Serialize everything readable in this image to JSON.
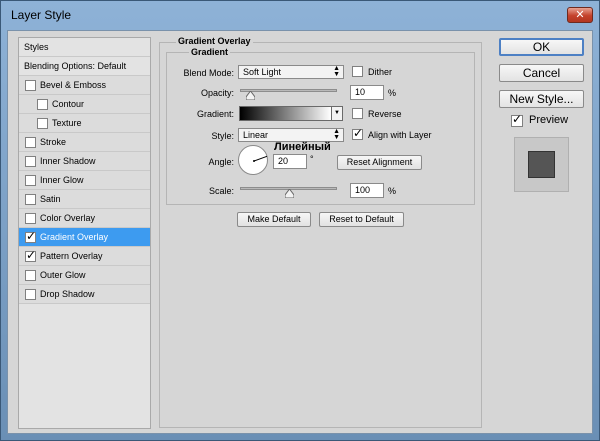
{
  "window": {
    "title": "Layer Style",
    "close_glyph": "✕"
  },
  "left_panel": {
    "items": [
      {
        "label": "Styles",
        "checkbox": false,
        "checked": false,
        "indent": false,
        "selected": false
      },
      {
        "label": "Blending Options: Default",
        "checkbox": false,
        "checked": false,
        "indent": false,
        "selected": false
      },
      {
        "label": "Bevel & Emboss",
        "checkbox": true,
        "checked": false,
        "indent": false,
        "selected": false
      },
      {
        "label": "Contour",
        "checkbox": true,
        "checked": false,
        "indent": true,
        "selected": false
      },
      {
        "label": "Texture",
        "checkbox": true,
        "checked": false,
        "indent": true,
        "selected": false
      },
      {
        "label": "Stroke",
        "checkbox": true,
        "checked": false,
        "indent": false,
        "selected": false
      },
      {
        "label": "Inner Shadow",
        "checkbox": true,
        "checked": false,
        "indent": false,
        "selected": false
      },
      {
        "label": "Inner Glow",
        "checkbox": true,
        "checked": false,
        "indent": false,
        "selected": false
      },
      {
        "label": "Satin",
        "checkbox": true,
        "checked": false,
        "indent": false,
        "selected": false
      },
      {
        "label": "Color Overlay",
        "checkbox": true,
        "checked": false,
        "indent": false,
        "selected": false
      },
      {
        "label": "Gradient Overlay",
        "checkbox": true,
        "checked": true,
        "indent": false,
        "selected": true
      },
      {
        "label": "Pattern Overlay",
        "checkbox": true,
        "checked": true,
        "indent": false,
        "selected": false
      },
      {
        "label": "Outer Glow",
        "checkbox": true,
        "checked": false,
        "indent": false,
        "selected": false
      },
      {
        "label": "Drop Shadow",
        "checkbox": true,
        "checked": false,
        "indent": false,
        "selected": false
      }
    ]
  },
  "gradient_overlay": {
    "section_title": "Gradient Overlay",
    "group_title": "Gradient",
    "blend_mode": {
      "label": "Blend Mode:",
      "value": "Soft Light"
    },
    "dither": {
      "label": "Dither",
      "checked": false
    },
    "opacity": {
      "label": "Opacity:",
      "value": "10",
      "unit": "%",
      "slider_fraction": 0.1
    },
    "gradient": {
      "label": "Gradient:",
      "colors": [
        "#000000",
        "#ffffff"
      ]
    },
    "reverse": {
      "label": "Reverse",
      "checked": false
    },
    "style": {
      "label": "Style:",
      "value": "Linear"
    },
    "align_with_layer": {
      "label": "Align with Layer",
      "checked": true
    },
    "angle": {
      "label": "Angle:",
      "value": "20",
      "unit": "°"
    },
    "reset_alignment": "Reset Alignment",
    "scale": {
      "label": "Scale:",
      "value": "100",
      "unit": "%",
      "slider_fraction": 0.5
    },
    "make_default": "Make Default",
    "reset_to_default": "Reset to Default",
    "overlay_annotation": "Линейный"
  },
  "right_panel": {
    "ok": "OK",
    "cancel": "Cancel",
    "new_style": "New Style...",
    "preview": {
      "label": "Preview",
      "checked": true
    },
    "preview_color": "#555555"
  },
  "check_glyph": "✓",
  "arrows_glyph": "▲▼",
  "dropdown_glyph": "▼"
}
